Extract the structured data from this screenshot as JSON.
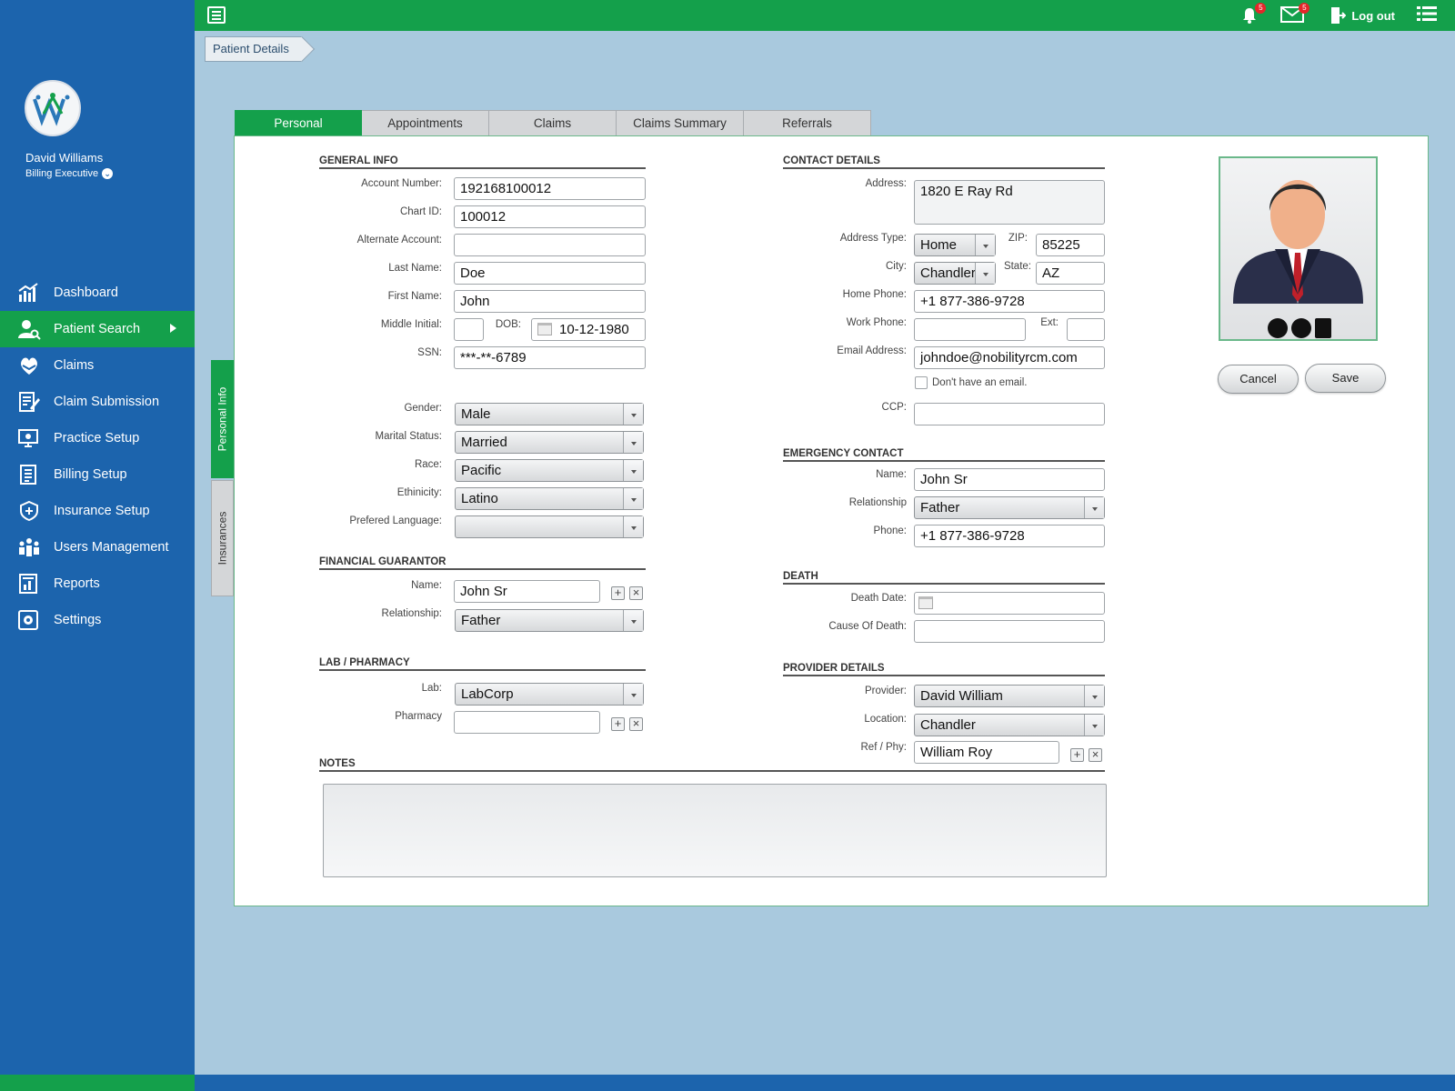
{
  "user": {
    "name": "David Williams",
    "role": "Billing Executive"
  },
  "nav": [
    {
      "label": "Dashboard",
      "icon": "chart-bar-icon"
    },
    {
      "label": "Patient Search",
      "icon": "patient-search-icon",
      "active": true
    },
    {
      "label": "Claims",
      "icon": "claims-icon"
    },
    {
      "label": "Claim Submission",
      "icon": "claim-submission-icon"
    },
    {
      "label": "Practice Setup",
      "icon": "practice-setup-icon"
    },
    {
      "label": "Billing Setup",
      "icon": "billing-setup-icon"
    },
    {
      "label": "Insurance Setup",
      "icon": "insurance-setup-icon"
    },
    {
      "label": "Users Management",
      "icon": "users-management-icon"
    },
    {
      "label": "Reports",
      "icon": "reports-icon"
    },
    {
      "label": "Settings",
      "icon": "settings-icon"
    }
  ],
  "topbar": {
    "notifications_count": "5",
    "messages_count": "5",
    "logout_label": "Log out"
  },
  "breadcrumb": "Patient Details",
  "tabs": [
    "Personal",
    "Appointments",
    "Claims",
    "Claims Summary",
    "Referrals"
  ],
  "side_tabs": {
    "personal": "Personal Info",
    "insurances": "Insurances"
  },
  "general": {
    "title": "GENERAL INFO",
    "account_label": "Account Number:",
    "account": "192168100012",
    "chart_label": "Chart ID:",
    "chart": "100012",
    "alt_label": "Alternate Account:",
    "alt": "",
    "last_label": "Last Name:",
    "last": "Doe",
    "first_label": "First Name:",
    "first": "John",
    "mi_label": "Middle Initial:",
    "mi": "",
    "dob_label": "DOB:",
    "dob": "10-12-1980",
    "ssn_label": "SSN:",
    "ssn": "***-**-6789",
    "gender_label": "Gender:",
    "gender": "Male",
    "marital_label": "Marital Status:",
    "marital": "Married",
    "race_label": "Race:",
    "race": "Pacific",
    "ethnicity_label": "Ethinicity:",
    "ethnicity": "Latino",
    "language_label": "Prefered Language:",
    "language": ""
  },
  "guarantor": {
    "title": "FINANCIAL GUARANTOR",
    "name_label": "Name:",
    "name": "John Sr",
    "rel_label": "Relationship:",
    "rel": "Father"
  },
  "lab": {
    "title": "LAB / PHARMACY",
    "lab_label": "Lab:",
    "lab": "LabCorp",
    "pharmacy_label": "Pharmacy",
    "pharmacy": ""
  },
  "contact": {
    "title": "CONTACT DETAILS",
    "address_label": "Address:",
    "address": "1820 E Ray Rd",
    "type_label": "Address Type:",
    "type": "Home",
    "zip_label": "ZIP:",
    "zip": "85225",
    "city_label": "City:",
    "city": "Chandler",
    "state_label": "State:",
    "state": "AZ",
    "home_label": "Home Phone:",
    "home": "+1 877-386-9728",
    "work_label": "Work Phone:",
    "work": "",
    "ext_label": "Ext:",
    "ext": "",
    "email_label": "Email Address:",
    "email": "johndoe@nobilityrcm.com",
    "no_email_label": "Don't have an email.",
    "ccp_label": "CCP:",
    "ccp": ""
  },
  "emergency": {
    "title": "EMERGENCY CONTACT",
    "name_label": "Name:",
    "name": "John Sr",
    "rel_label": "Relationship",
    "rel": "Father",
    "phone_label": "Phone:",
    "phone": "+1 877-386-9728"
  },
  "death": {
    "title": "DEATH",
    "date_label": "Death Date:",
    "date": "",
    "cause_label": "Cause Of Death:",
    "cause": ""
  },
  "provider": {
    "title": "PROVIDER DETAILS",
    "provider_label": "Provider:",
    "provider": "David William",
    "location_label": "Location:",
    "location": "Chandler",
    "ref_label": "Ref / Phy:",
    "ref": "William Roy"
  },
  "notes": {
    "title": "NOTES",
    "value": ""
  },
  "actions": {
    "cancel": "Cancel",
    "save": "Save"
  }
}
